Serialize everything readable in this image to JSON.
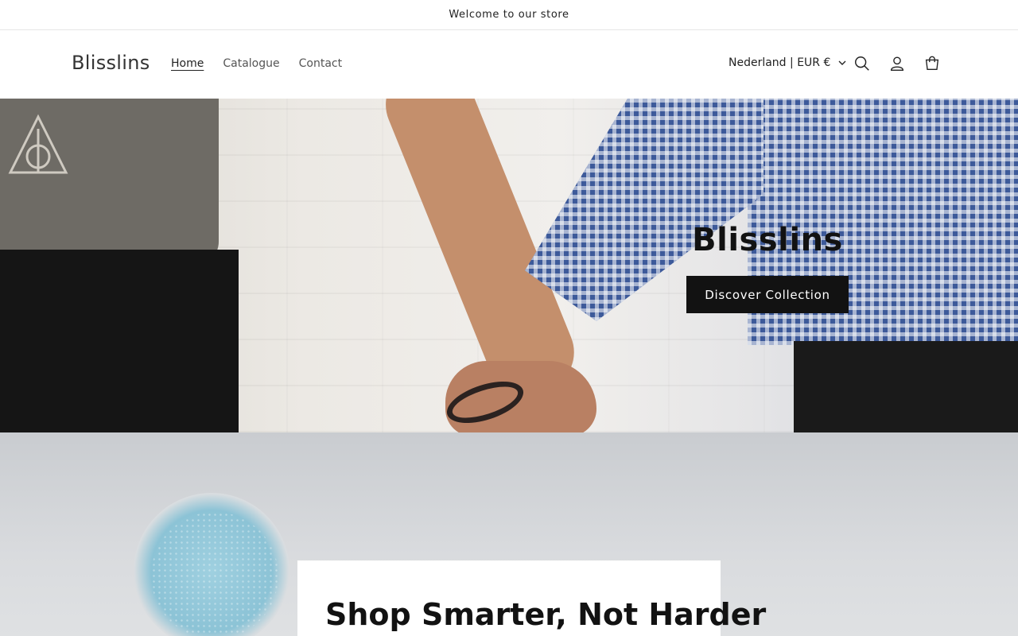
{
  "announcement": {
    "text": "Welcome to our store"
  },
  "header": {
    "logo": "Blisslins",
    "nav": [
      {
        "label": "Home",
        "active": true
      },
      {
        "label": "Catalogue",
        "active": false
      },
      {
        "label": "Contact",
        "active": false
      }
    ],
    "localization": "Nederland | EUR €",
    "icons": [
      "search-icon",
      "account-icon",
      "cart-icon"
    ]
  },
  "hero": {
    "title": "Blisslins",
    "button_label": "Discover Collection"
  },
  "promo": {
    "title": "Shop Smarter, Not Harder"
  },
  "colors": {
    "button_bg": "#121212",
    "button_text": "#ffffff",
    "text": "#121212"
  }
}
